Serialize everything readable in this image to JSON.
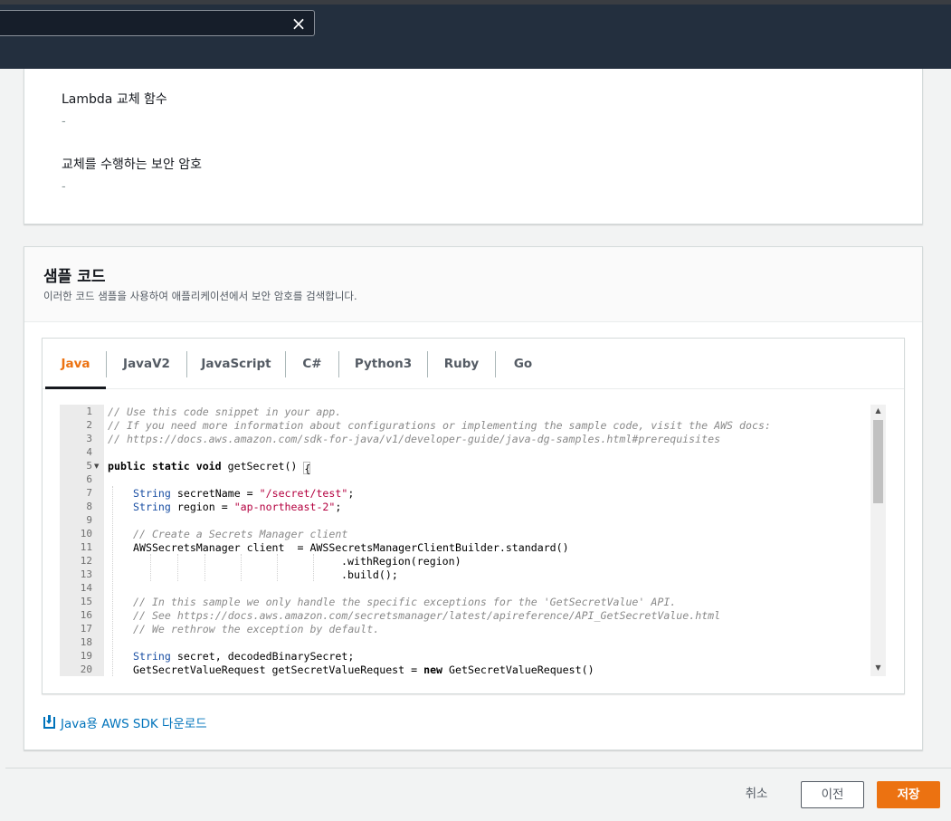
{
  "header": {
    "search_value": "",
    "clear_label": "×"
  },
  "details": {
    "fields": [
      {
        "label": "Lambda 교체 함수",
        "value": "-"
      },
      {
        "label": "교체를 수행하는 보안 암호",
        "value": "-"
      }
    ]
  },
  "sample_code": {
    "title": "샘플 코드",
    "description": "이러한 코드 샘플을 사용하여 애플리케이션에서 보안 암호를 검색합니다.",
    "tabs": [
      "Java",
      "JavaV2",
      "JavaScript",
      "C#",
      "Python3",
      "Ruby",
      "Go"
    ],
    "active_tab": "Java",
    "line_numbers": [
      "1",
      "2",
      "3",
      "4",
      "5",
      "6",
      "7",
      "8",
      "9",
      "10",
      "11",
      "12",
      "13",
      "14",
      "15",
      "16",
      "17",
      "18",
      "19",
      "20"
    ],
    "code": {
      "l1": "// Use this code snippet in your app.",
      "l2": "// If you need more information about configurations or implementing the sample code, visit the AWS docs:",
      "l3": "// https://docs.aws.amazon.com/sdk-for-java/v1/developer-guide/java-dg-samples.html#prerequisites",
      "l5_kw": "public static void",
      "l5_rest": " getSecret() ",
      "l7_type": "String",
      "l7_mid": " secretName = ",
      "l7_str": "\"/secret/test\"",
      "l7_end": ";",
      "l8_type": "String",
      "l8_mid": " region = ",
      "l8_str": "\"ap-northeast-2\"",
      "l8_end": ";",
      "l10": "// Create a Secrets Manager client",
      "l11": "AWSSecretsManager client  = AWSSecretsManagerClientBuilder.standard()",
      "l12": ".withRegion(region)",
      "l13": ".build();",
      "l15": "// In this sample we only handle the specific exceptions for the 'GetSecretValue' API.",
      "l16": "// See https://docs.aws.amazon.com/secretsmanager/latest/apireference/API_GetSecretValue.html",
      "l17": "// We rethrow the exception by default.",
      "l19_type": "String",
      "l19_rest": " secret, decodedBinarySecret;",
      "l20_a": "GetSecretValueRequest getSecretValueRequest = ",
      "l20_kw": "new",
      "l20_b": " GetSecretValueRequest()"
    },
    "download_link": "Java용 AWS SDK 다운로드"
  },
  "footer": {
    "cancel": "취소",
    "previous": "이전",
    "save": "저장"
  },
  "colors": {
    "accent": "#ec7211",
    "link": "#0073bb",
    "header_bg": "#232f3e"
  }
}
